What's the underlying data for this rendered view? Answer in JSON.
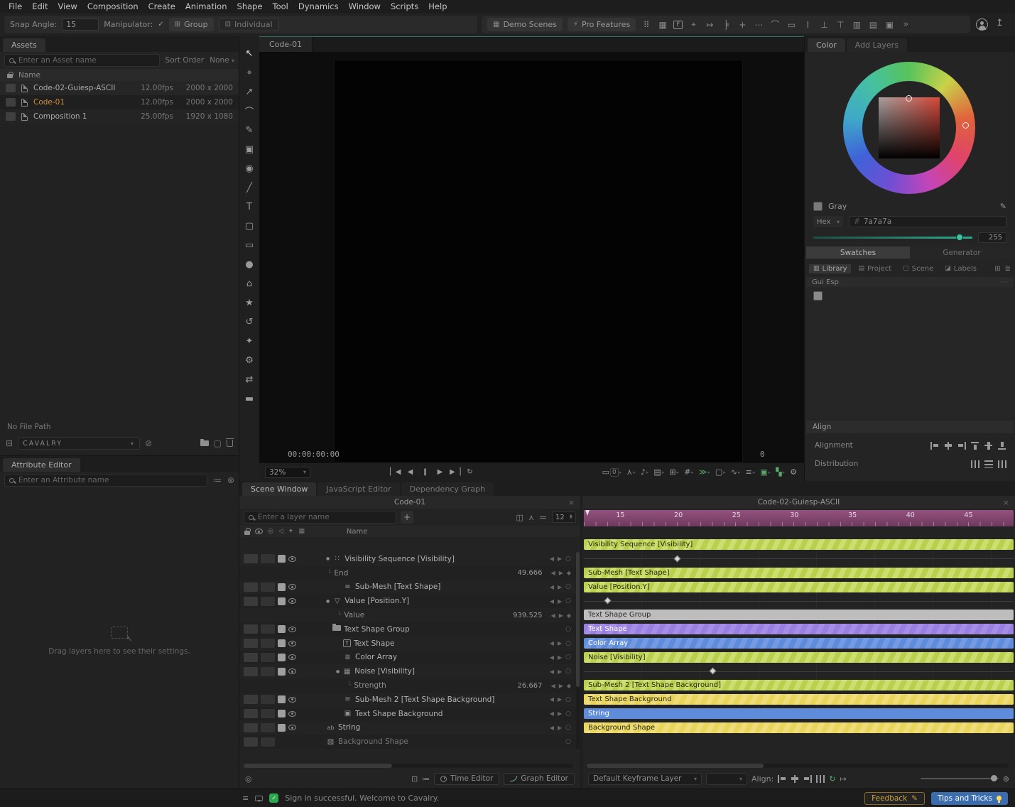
{
  "menubar": {
    "items": [
      "File",
      "Edit",
      "View",
      "Composition",
      "Create",
      "Animation",
      "Shape",
      "Tool",
      "Dynamics",
      "Window",
      "Scripts",
      "Help"
    ]
  },
  "toolbar": {
    "snap_angle_label": "Snap Angle:",
    "snap_angle_value": "15",
    "manipulator_label": "Manipulator:",
    "group_label": "Group",
    "individual_label": "Individual",
    "demo_scenes_label": "Demo Scenes",
    "pro_features_label": "Pro Features"
  },
  "assets": {
    "tab_label": "Assets",
    "search_placeholder": "Enter an Asset name",
    "sort_order_label": "Sort Order",
    "sort_order_value": "None",
    "name_header": "Name",
    "rows": [
      {
        "name": "Code-02-Guiesp-ASCII",
        "fps": "12.00fps",
        "size": "2000 x 2000"
      },
      {
        "name": "Code-01",
        "fps": "12.00fps",
        "size": "2000 x 2000"
      },
      {
        "name": "Composition 1",
        "fps": "25.00fps",
        "size": "1920 x 1080"
      }
    ],
    "file_path_label": "No File Path",
    "project_selector": "CAVALRY"
  },
  "attribute_editor": {
    "tab_label": "Attribute Editor",
    "search_placeholder": "Enter an Attribute name",
    "empty_message": "Drag layers here to see their settings."
  },
  "viewport": {
    "tab_label": "Code-01",
    "timecode": "00:00:00:00",
    "frame_display": "0",
    "zoom_value": "32%"
  },
  "scene": {
    "tabs": [
      {
        "label": "Scene Window"
      },
      {
        "label": "JavaScript Editor"
      },
      {
        "label": "Dependency Graph"
      }
    ],
    "left_pane_title": "Code-01",
    "right_pane_title": "Code-02-Guiesp-ASCII",
    "search_placeholder": "Enter a layer name",
    "filter_value": "12",
    "name_header": "Name",
    "layers": [
      {
        "label": "Visibility Sequence [Visibility]"
      },
      {
        "label": "End",
        "value": "49.666"
      },
      {
        "label": "Sub-Mesh [Text Shape]"
      },
      {
        "label": "Value [Position.Y]"
      },
      {
        "label": "Value",
        "value": "939.525"
      },
      {
        "label": "Text Shape Group"
      },
      {
        "label": "Text Shape"
      },
      {
        "label": "Color Array"
      },
      {
        "label": "Noise [Visibility]"
      },
      {
        "label": "Strength",
        "value": "26.667"
      },
      {
        "label": "Sub-Mesh 2 [Text Shape Background]"
      },
      {
        "label": "Text Shape Background"
      },
      {
        "label": "String"
      },
      {
        "label": "Background Shape"
      }
    ],
    "timeline": {
      "ruler_ticks": [
        "15",
        "20",
        "25",
        "30",
        "35",
        "40",
        "45"
      ],
      "tracks": [
        {
          "type": "bar",
          "label": "Visibility Sequence [Visibility]",
          "style": "green"
        },
        {
          "type": "keys",
          "pos": 21.2
        },
        {
          "type": "bar",
          "label": "Sub-Mesh [Text Shape]",
          "style": "green"
        },
        {
          "type": "bar",
          "label": "Value [Position.Y]",
          "style": "green"
        },
        {
          "type": "keys",
          "pos": 5.0
        },
        {
          "type": "bar",
          "label": "Text Shape Group",
          "style": "gray"
        },
        {
          "type": "bar",
          "label": "Text Shape",
          "style": "purple"
        },
        {
          "type": "bar",
          "label": "Color Array",
          "style": "bluestripe"
        },
        {
          "type": "bar",
          "label": "Noise [Visibility]",
          "style": "green"
        },
        {
          "type": "keys",
          "pos": 29.5
        },
        {
          "type": "bar",
          "label": "Sub-Mesh 2 [Text Shape Background]",
          "style": "green"
        },
        {
          "type": "bar",
          "label": "Text Shape Background",
          "style": "yellow"
        },
        {
          "type": "bar",
          "label": "String",
          "style": "blue"
        },
        {
          "type": "bar",
          "label": "Background Shape",
          "style": "yellow"
        }
      ]
    },
    "footer": {
      "time_editor_label": "Time Editor",
      "graph_editor_label": "Graph Editor",
      "keyframe_layer_value": "Default Keyframe Layer",
      "align_label": "Align:"
    }
  },
  "color_panel": {
    "tabs": [
      {
        "label": "Color"
      },
      {
        "label": "Add Layers"
      }
    ],
    "color_name": "Gray",
    "hex_label": "Hex",
    "hex_value": "7a7a7a",
    "alpha_value": "255",
    "swatches_tab": "Swatches",
    "generator_tab": "Generator",
    "library_tabs": [
      "Library",
      "Project",
      "Scene",
      "Labels"
    ],
    "swatch_group_label": "Gui Esp"
  },
  "align_panel": {
    "title": "Align",
    "alignment_label": "Alignment",
    "distribution_label": "Distribution"
  },
  "statusbar": {
    "message": "Sign in successful. Welcome to Cavalry.",
    "feedback_label": "Feedback",
    "tips_label": "Tips and Tricks"
  },
  "colors": {
    "highlight_orange": "#d28e3c",
    "bar_green": "#bfd24f",
    "bar_purple": "#997fe0",
    "bar_blue": "#5f8cda",
    "bar_yellow": "#e9d45c",
    "bar_gray": "#bdbdbd",
    "ruler_purple": "#8e4e79",
    "tips_button_blue": "#3a6cae",
    "feedback_yellow": "#cfa43a",
    "current_swatch": "#7a7a7a",
    "alpha_teal": "#2ea88c"
  }
}
